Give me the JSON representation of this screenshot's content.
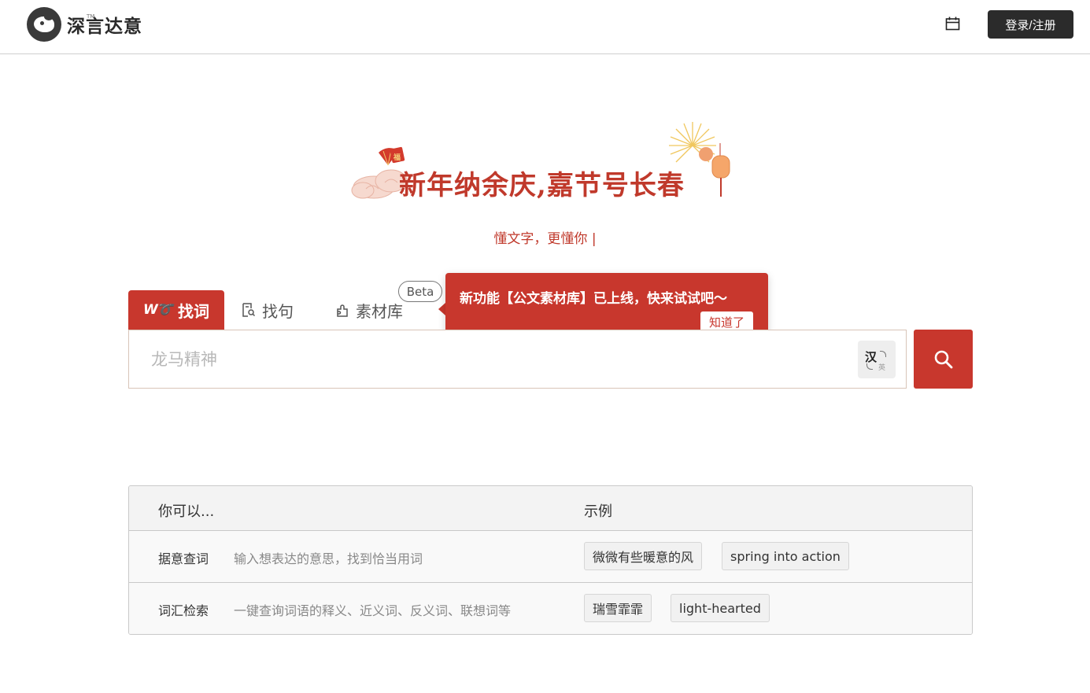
{
  "header": {
    "logo_text": "深言达意",
    "logo_tm": "TM",
    "login_label": "登录/注册"
  },
  "banner": {
    "title": "新年纳余庆,嘉节号长春",
    "badge_char": "福"
  },
  "tagline": "懂文字，更懂你 |",
  "tabs": [
    {
      "label": "找词",
      "icon": "wq-logo-icon",
      "active": true
    },
    {
      "label": "找句",
      "icon": "document-search-icon",
      "active": false
    },
    {
      "label": "素材库",
      "icon": "puzzle-icon",
      "active": false
    }
  ],
  "beta_label": "Beta",
  "tooltip": {
    "text": "新功能【公文素材库】已上线，快来试试吧～",
    "button_label": "知道了"
  },
  "search": {
    "placeholder": "龙马精神",
    "lang_toggle_zh": "汉",
    "lang_toggle_en": "英"
  },
  "help_table": {
    "headers": [
      "你可以...",
      "示例"
    ],
    "rows": [
      {
        "feature": "据意查词",
        "description": "输入想表达的意思，找到恰当用词",
        "examples": [
          "微微有些暖意的风",
          "spring into action"
        ]
      },
      {
        "feature": "词汇检索",
        "description": "一键查询词语的释义、近义词、反义词、联想词等",
        "examples": [
          "瑞雪霏霏",
          "light-hearted"
        ]
      }
    ]
  },
  "colors": {
    "accent": "#c8372d",
    "dark_button": "#2b2b2b"
  }
}
